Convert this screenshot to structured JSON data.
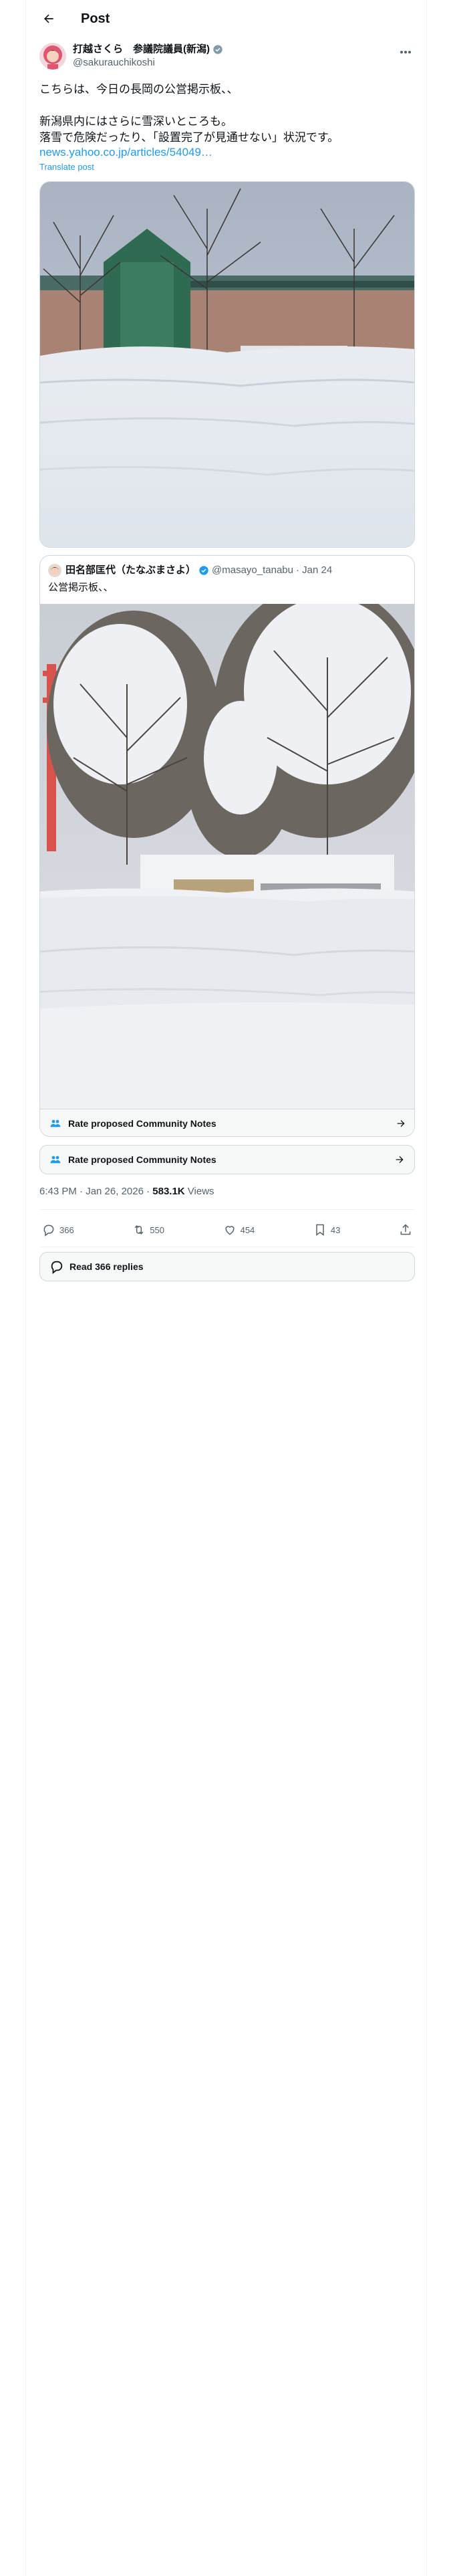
{
  "header": {
    "title": "Post"
  },
  "author": {
    "name": "打越さくら　参議院議員(新潟)",
    "handle": "@sakurauchikoshi"
  },
  "tweet": {
    "text": "こちらは、今日の長岡の公営掲示板、、\n\n新潟県内にはさらに雪深いところも。\n落雪で危険だったり、「設置完了が見通せない」状況です。",
    "link": "news.yahoo.co.jp/articles/54049…",
    "translate": "Translate post"
  },
  "quote": {
    "name": "田名部匡代（たなぶまさよ）",
    "handle": "@masayo_tanabu",
    "date": "· Jan 24",
    "text": "公営掲示板、、"
  },
  "community_notes": {
    "quote_label": "Rate proposed Community Notes",
    "main_label": "Rate proposed Community Notes"
  },
  "meta": {
    "time": "6:43 PM · Jan 26, 2026 · ",
    "views_count": "583.1K",
    "views_label": " Views"
  },
  "actions": {
    "replies": "366",
    "reposts": "550",
    "likes": "454",
    "bookmarks": "43"
  },
  "read_replies": "Read 366 replies",
  "icons": [
    "back-arrow-icon",
    "verified-badge-icon",
    "more-icon",
    "community-notes-icon",
    "arrow-right-icon",
    "reply-icon",
    "repost-icon",
    "like-icon",
    "bookmark-icon",
    "share-icon",
    "speech-bubble-icon"
  ],
  "colors": {
    "accent": "#1d9bf0",
    "text": "#0f1419",
    "muted": "#536471",
    "border": "#cfd9de"
  }
}
